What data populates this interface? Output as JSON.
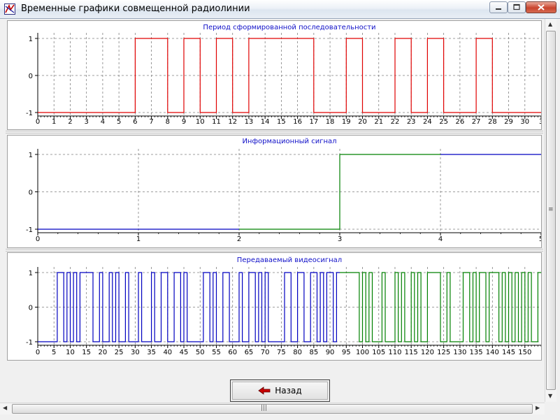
{
  "window": {
    "title": "Временные графики совмещенной радиолинии",
    "icon": "app-signal-icon"
  },
  "buttons": {
    "back_label": "Назад",
    "back_icon": "arrow-left-icon"
  },
  "colors": {
    "title_blue": "#1010c8",
    "red": "#e00000",
    "blue": "#0000c0",
    "green": "#008000",
    "grid": "#808080"
  },
  "chart_data": [
    {
      "type": "line",
      "step": true,
      "title": "Период сформированной последовательности",
      "xlim": [
        0,
        31
      ],
      "ylim": [
        -1,
        1
      ],
      "x_ticks": [
        0,
        1,
        2,
        3,
        4,
        5,
        6,
        7,
        8,
        9,
        10,
        11,
        12,
        13,
        14,
        15,
        16,
        17,
        18,
        19,
        20,
        21,
        22,
        23,
        24,
        25,
        26,
        27,
        28,
        29,
        30,
        31
      ],
      "x_tick_labels": [
        "0",
        "1",
        "2",
        "3",
        "4",
        "5",
        "6",
        "7",
        "8",
        "9",
        "10",
        "11",
        "12",
        "13",
        "14",
        "15",
        "16",
        "17",
        "18",
        "19",
        "20",
        "21",
        "22",
        "23",
        "24",
        "25",
        "26",
        "27",
        "28",
        "29",
        "30",
        "3"
      ],
      "y_ticks": [
        -1,
        0,
        1
      ],
      "y_tick_labels": [
        "-1",
        "0",
        "1"
      ],
      "grid": true,
      "series": [
        {
          "color": "#e00000",
          "start": -1,
          "edges": [
            6,
            8,
            9,
            10,
            11,
            12,
            13,
            17,
            19,
            20,
            22,
            23,
            24,
            25,
            27,
            28
          ]
        }
      ]
    },
    {
      "type": "line",
      "step": true,
      "title": "Информационный сигнал",
      "xlim": [
        0,
        5
      ],
      "ylim": [
        -1,
        1
      ],
      "x_ticks": [
        0,
        1,
        2,
        3,
        4,
        5
      ],
      "x_tick_labels": [
        "0",
        "1",
        "2",
        "3",
        "4",
        "5"
      ],
      "y_ticks": [
        -1,
        0,
        1
      ],
      "y_tick_labels": [
        "-1",
        "0",
        "1"
      ],
      "grid": true,
      "series": [
        {
          "color": "#0000c0",
          "x": [
            0,
            2
          ],
          "y": [
            -1,
            -1
          ]
        },
        {
          "color": "#008000",
          "x": [
            2,
            3,
            3,
            4
          ],
          "y": [
            -1,
            -1,
            1,
            1
          ]
        },
        {
          "color": "#0000c0",
          "x": [
            4,
            5
          ],
          "y": [
            1,
            1
          ]
        }
      ]
    },
    {
      "type": "line",
      "step": true,
      "title": "Передаваемый видеосигнал",
      "xlim": [
        0,
        155
      ],
      "ylim": [
        -1,
        1
      ],
      "x_ticks": [
        0,
        5,
        10,
        15,
        20,
        25,
        30,
        35,
        40,
        45,
        50,
        55,
        60,
        65,
        70,
        75,
        80,
        85,
        90,
        95,
        100,
        105,
        110,
        115,
        120,
        125,
        130,
        135,
        140,
        145,
        150
      ],
      "x_tick_labels": [
        "0",
        "5",
        "10",
        "15",
        "20",
        "25",
        "30",
        "35",
        "40",
        "45",
        "50",
        "55",
        "60",
        "65",
        "70",
        "75",
        "80",
        "85",
        "90",
        "95",
        "100",
        "105",
        "110",
        "115",
        "120",
        "125",
        "130",
        "135",
        "140",
        "145",
        "150"
      ],
      "y_ticks": [
        -1,
        0,
        1
      ],
      "y_tick_labels": [
        "-1",
        "0",
        "1"
      ],
      "grid": true,
      "series": [
        {
          "color": "#0000c0",
          "start": -1,
          "range": [
            0,
            93
          ],
          "edges": [
            6,
            8,
            9,
            10,
            11,
            12,
            13,
            17,
            19,
            20,
            22,
            23,
            24,
            25,
            27,
            28,
            31,
            32,
            35,
            36,
            38,
            40,
            42,
            44,
            45,
            46,
            51,
            53,
            54,
            55,
            57,
            59,
            62,
            63,
            65,
            67,
            68,
            69,
            70,
            71,
            76,
            78,
            80,
            82,
            84,
            86,
            87,
            88,
            89,
            91,
            92
          ]
        },
        {
          "color": "#008000",
          "start": 1,
          "range": [
            93,
            155
          ],
          "edges": [
            99,
            100,
            101,
            102,
            103,
            106,
            107,
            110,
            111,
            112,
            113,
            115,
            116,
            117,
            118,
            120,
            124,
            126,
            127,
            131,
            133,
            134,
            135,
            136,
            138,
            139,
            142,
            143,
            144,
            145,
            146,
            147,
            148,
            149,
            150,
            151,
            152,
            154
          ]
        }
      ]
    }
  ]
}
